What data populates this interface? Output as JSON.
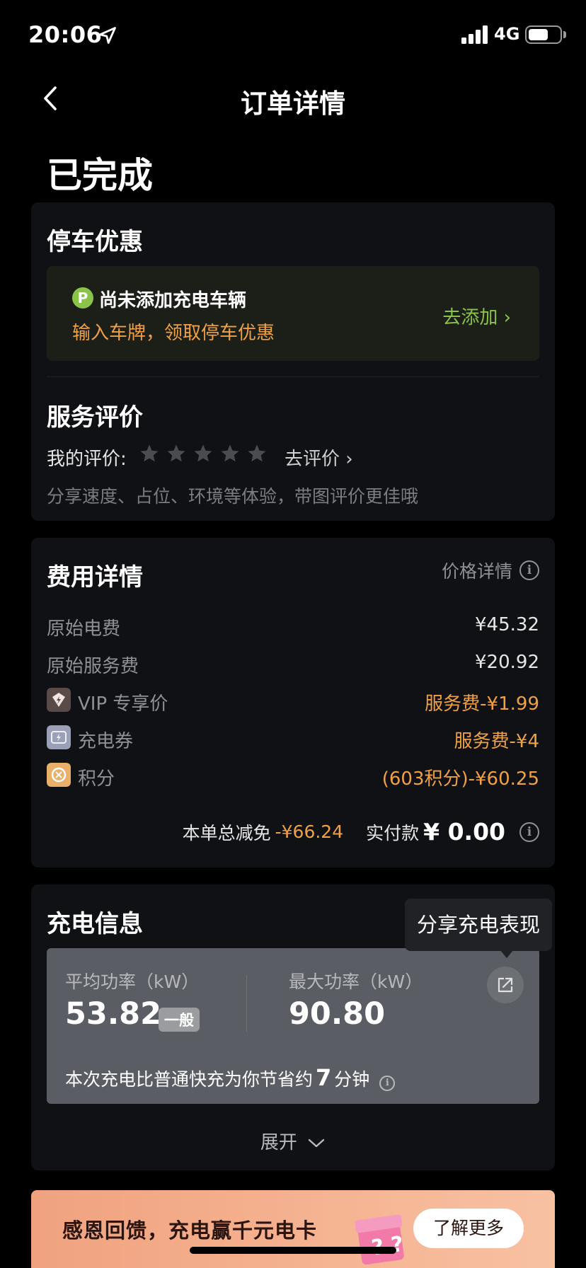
{
  "status_bar": {
    "time": "20:06",
    "network": "4G"
  },
  "nav": {
    "title": "订单详情"
  },
  "order_status": "已完成",
  "parking": {
    "title": "停车优惠",
    "icon_letter": "P",
    "vehicle_title": "尚未添加充电车辆",
    "subtitle": "输入车牌，领取停车优惠",
    "add_label": "去添加 ›"
  },
  "service_rating": {
    "title": "服务评价",
    "my_rating_label": "我的评价:",
    "stars_filled": 0,
    "stars_total": 5,
    "go_rate_label": "去评价 ›",
    "hint": "分享速度、占位、环境等体验，带图评价更佳哦"
  },
  "fees": {
    "title": "费用详情",
    "price_detail_label": "价格详情",
    "rows": [
      {
        "label": "原始电费",
        "value": "¥45.32",
        "icon": ""
      },
      {
        "label": "原始服务费",
        "value": "¥20.92",
        "icon": ""
      },
      {
        "label": "VIP 专享价",
        "value": "服务费-¥1.99",
        "icon": "vip-icon"
      },
      {
        "label": "充电券",
        "value": "服务费-¥4",
        "icon": "coupon-icon"
      },
      {
        "label": "积分",
        "value": "(603积分)-¥60.25",
        "icon": "points-icon"
      }
    ],
    "total_discount_label": "本单总减免",
    "total_discount_value": "-¥66.24",
    "paid_label": "实付款",
    "paid_value": "¥ 0.00"
  },
  "charging": {
    "title": "充电信息",
    "tooltip": "分享充电表现",
    "avg_power_label": "平均功率（kW）",
    "avg_power_value": "53.82",
    "avg_power_badge": "一般",
    "max_power_label": "最大功率（kW）",
    "max_power_value": "90.80",
    "note_prefix": "本次充电比普通快充为你节省约",
    "note_number": "7",
    "note_suffix": "分钟",
    "expand_label": "展开"
  },
  "banner": {
    "text": "感恩回馈，充电赢千元电卡",
    "button_label": "了解更多"
  },
  "colors": {
    "accent_orange": "#f0a145",
    "accent_green": "#8bc34a",
    "card_bg": "#101114"
  }
}
